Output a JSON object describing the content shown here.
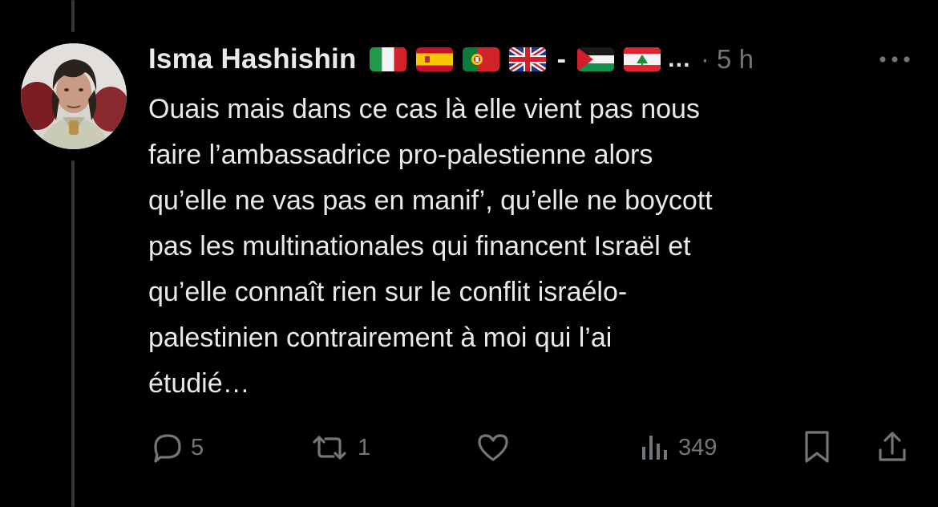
{
  "tweet": {
    "author": {
      "name": "Isma Hashishin",
      "avatar_icon": "profile-photo-avatar",
      "flags": [
        "flag-italy-icon",
        "flag-spain-icon",
        "flag-portugal-icon",
        "flag-uk-icon",
        "flag-palestine-icon",
        "flag-lebanon-icon"
      ],
      "name_separator": "-",
      "truncation": "…"
    },
    "timestamp": "· 5 h",
    "text": "Ouais mais dans ce cas là elle vient pas nous\nfaire l’ambassadrice pro-palestienne alors\nqu’elle ne vas pas en manif’, qu’elle ne boycott\npas les multinationales qui financent Israël et\nqu’elle connaît rien sur le conflit israélo-\npalestinien contrairement à moi qui l’ai\nétudié…",
    "actions": {
      "replies": "5",
      "reposts": "1",
      "likes": "",
      "views": "349"
    }
  },
  "colors": {
    "background": "#000000",
    "text_primary": "#e7e9ea",
    "text_secondary": "#71767b",
    "thread_line": "#333639"
  }
}
